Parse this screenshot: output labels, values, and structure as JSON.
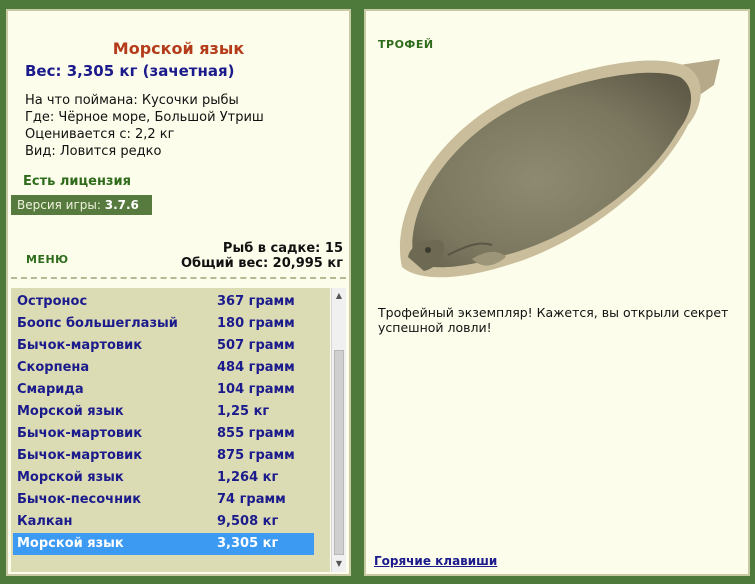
{
  "catch": {
    "title": "Морской язык",
    "weight": "Вес: 3,305 кг (зачетная)",
    "bait": "На что поймана: Кусочки рыбы",
    "place": "Где: Чёрное море, Большой Утриш",
    "valued_from": "Оценивается с: 2,2 кг",
    "kind": "Вид: Ловится редко"
  },
  "license": "Есть лицензия",
  "version": {
    "label": "Версия игры:",
    "value": "3.7.6"
  },
  "menu_label": "МЕНЮ",
  "keep_net": {
    "fish_count": "Рыб в садке: 15",
    "total_weight": "Общий вес: 20,995 кг"
  },
  "fish_list": [
    {
      "name": "Остронос",
      "weight": "367 грамм"
    },
    {
      "name": "Боопс большеглазый",
      "weight": "180 грамм"
    },
    {
      "name": "Бычок-мартовик",
      "weight": "507 грамм"
    },
    {
      "name": "Скорпена",
      "weight": "484 грамм"
    },
    {
      "name": "Смарида",
      "weight": "104 грамм"
    },
    {
      "name": "Морской язык",
      "weight": "1,25 кг"
    },
    {
      "name": "Бычок-мартовик",
      "weight": "855 грамм"
    },
    {
      "name": "Бычок-мартовик",
      "weight": "875 грамм"
    },
    {
      "name": "Морской язык",
      "weight": "1,264 кг"
    },
    {
      "name": "Бычок-песочник",
      "weight": "74 грамм"
    },
    {
      "name": "Калкан",
      "weight": "9,508 кг"
    },
    {
      "name": "Морской язык",
      "weight": "3,305 кг"
    }
  ],
  "selected_index": 11,
  "trophy_label": "ТРОФЕЙ",
  "trophy_text": "Трофейный экземпляр! Кажется, вы открыли секрет успешной ловли!",
  "hotkeys_link": "Горячие клавиши",
  "icons": {
    "scroll_up": "scroll-up-arrow-icon",
    "scroll_down": "scroll-down-arrow-icon",
    "fish_image": "flatfish-sole-image"
  },
  "colors": {
    "background": "#4e7a3b",
    "panel": "#fdfdec",
    "title": "#b43c1a",
    "link": "#1b1b8c",
    "selection": "#3c9af3",
    "list_bg": "#dcdcb4"
  }
}
